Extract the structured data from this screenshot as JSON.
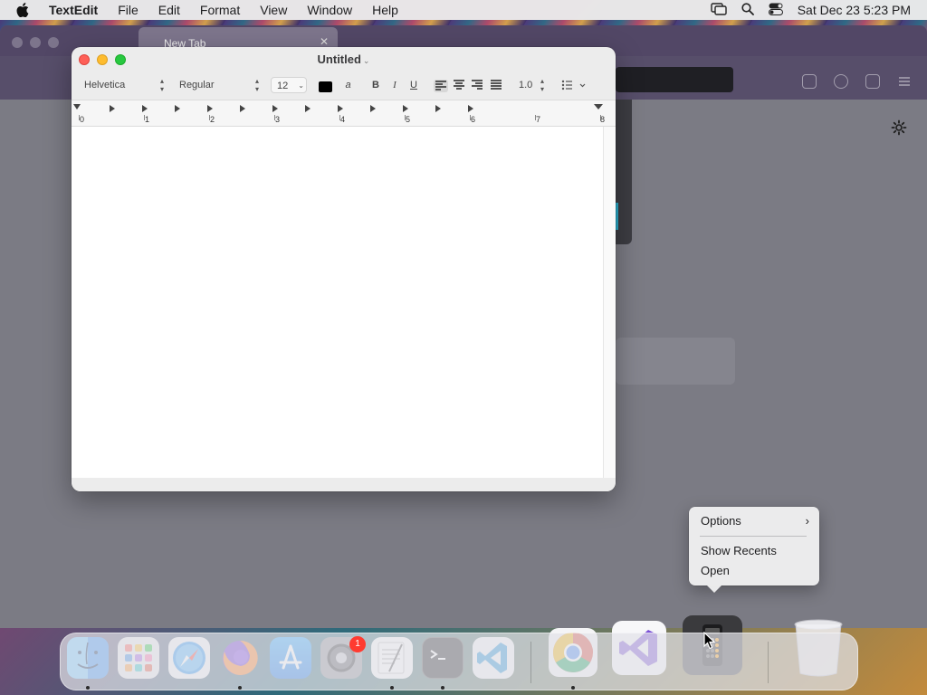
{
  "menubar": {
    "app_name": "TextEdit",
    "items": [
      "File",
      "Edit",
      "Format",
      "View",
      "Window",
      "Help"
    ],
    "datetime": "Sat Dec 23  5:23 PM"
  },
  "browser": {
    "tab_title": "New Tab"
  },
  "textedit": {
    "title": "Untitled",
    "font_family": "Helvetica",
    "font_style": "Regular",
    "font_size": "12",
    "line_spacing": "1.0",
    "bold": "B",
    "italic": "I",
    "underline": "U",
    "ruler_numbers": [
      "0",
      "1",
      "2",
      "3",
      "4",
      "5",
      "6",
      "7",
      "8"
    ]
  },
  "context_menu": {
    "items": [
      {
        "label": "Options",
        "has_submenu": true
      },
      {
        "label": "Show Recents",
        "has_submenu": false
      },
      {
        "label": "Open",
        "has_submenu": false
      }
    ]
  },
  "dock": {
    "apps": [
      "finder",
      "launchpad",
      "safari",
      "firefox",
      "app-store",
      "system-settings",
      "textedit",
      "terminal",
      "vscode",
      "chrome",
      "visual-studio",
      "calculator",
      "trash"
    ],
    "settings_badge": "1"
  }
}
